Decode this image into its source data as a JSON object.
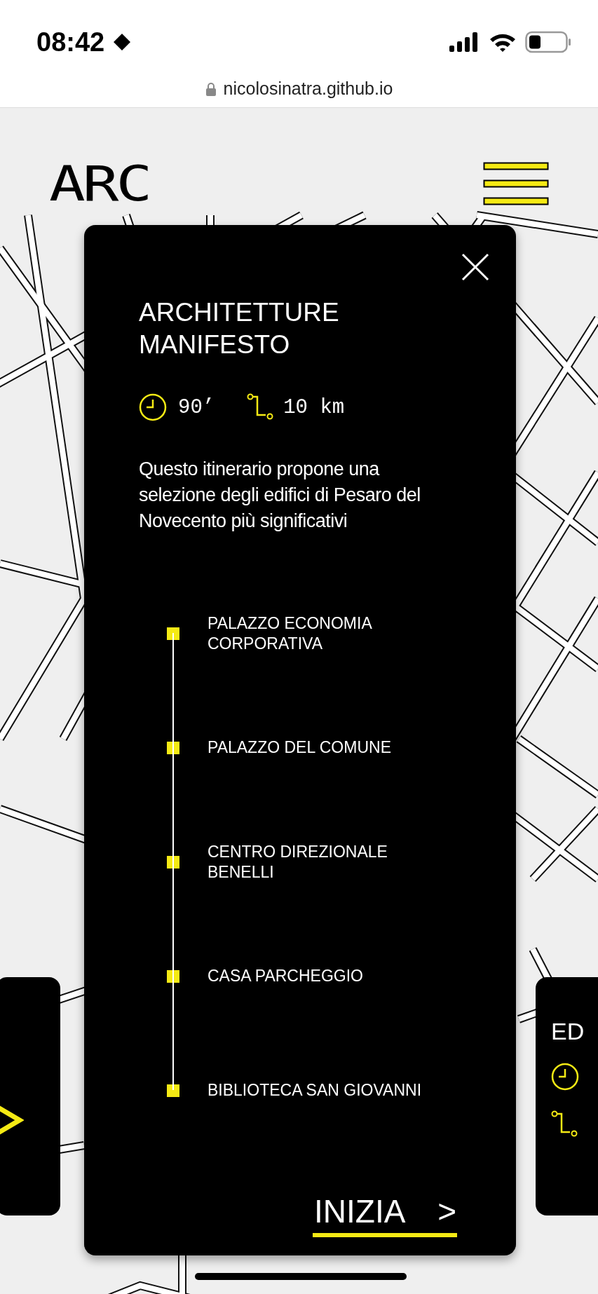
{
  "status_bar": {
    "time": "08:42"
  },
  "browser": {
    "url": "nicolosinatra.github.io"
  },
  "header": {
    "logo": "ARC"
  },
  "card": {
    "title": "ARCHITETTURE MANIFESTO",
    "duration": "90’",
    "distance": "10 km",
    "description": "Questo itinerario propone una selezione degli edifici di Pesaro del Novecento più significativi",
    "stops": [
      {
        "name": "PALAZZO ECONOMIA CORPORATIVA"
      },
      {
        "name": "PALAZZO DEL COMUNE"
      },
      {
        "name": "CENTRO DIREZIONALE BENELLI"
      },
      {
        "name": "CASA PARCHEGGIO"
      },
      {
        "name": "BIBLIOTECA SAN GIOVANNI"
      }
    ],
    "start_button": "INIZIA",
    "start_arrow": ">"
  },
  "next_card": {
    "title": "ED"
  }
}
